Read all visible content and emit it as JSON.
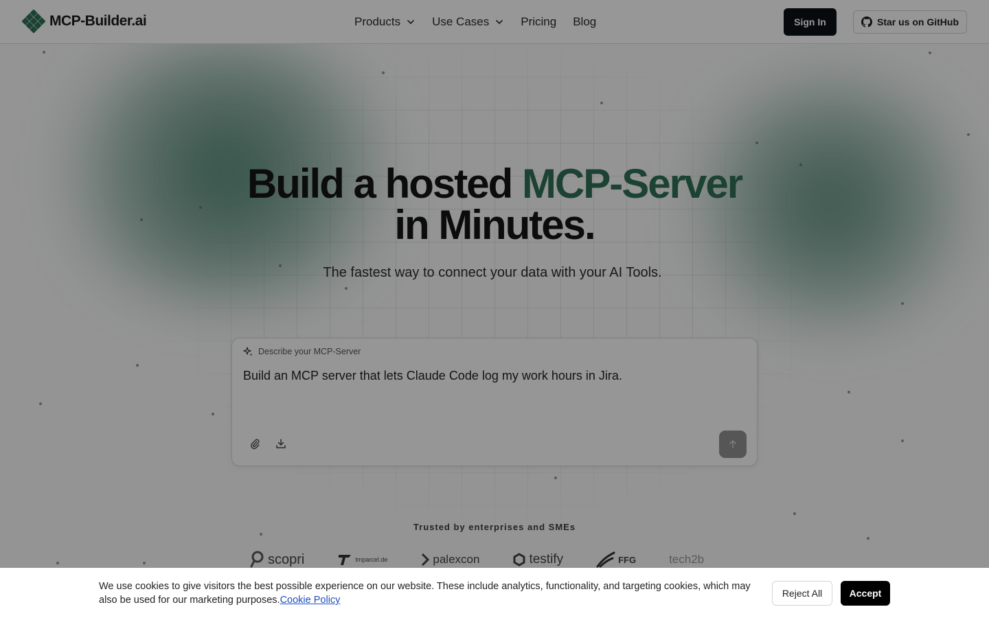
{
  "header": {
    "logo_text": "MCP-Builder.ai",
    "nav": {
      "products": "Products",
      "use_cases": "Use Cases",
      "pricing": "Pricing",
      "blog": "Blog"
    },
    "sign_in": "Sign In",
    "github": "Star us on GitHub"
  },
  "hero": {
    "title_part1": "Build a hosted ",
    "title_accent": "MCP-Server",
    "title_line2": "in Minutes.",
    "subtitle": "The fastest way to connect your data with your AI Tools."
  },
  "prompt": {
    "label": "Describe your MCP-Server",
    "text": "Build an MCP server that lets Claude Code log my work hours in Jira."
  },
  "trusted": {
    "heading": "Trusted by enterprises and SMEs",
    "brands": {
      "scopri": "scopri",
      "tmparcel": "tmparcel.de",
      "palexcon": "palexcon",
      "testify": "testify",
      "ffg": "FFG",
      "tech2b": "tech2b"
    }
  },
  "cookie": {
    "text": "We use cookies to give visitors the best possible experience on our website. These include analytics, functionality, and targeting cookies, which may also be used for our marketing purposes.",
    "link": "Cookie Policy",
    "reject": "Reject All",
    "accept": "Accept"
  },
  "colors": {
    "accent": "#2d6f55",
    "dark_button": "#0c1116",
    "link": "#1f4fbf"
  }
}
